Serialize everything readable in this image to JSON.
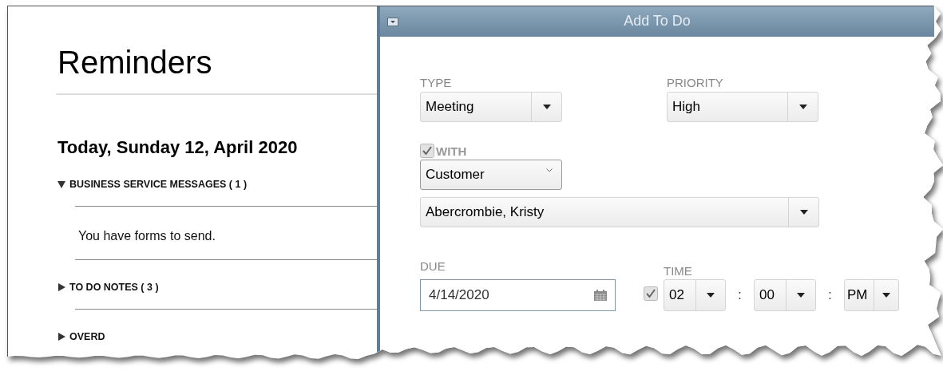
{
  "reminders": {
    "title": "Reminders",
    "date_heading": "Today, Sunday 12, April 2020",
    "sections": [
      {
        "label": "BUSINESS SERVICE MESSAGES ( 1 )",
        "expanded": true,
        "items": [
          "You have forms to send."
        ]
      },
      {
        "label": "TO DO NOTES ( 3 )",
        "expanded": false
      },
      {
        "label": "OVERD",
        "expanded": false
      }
    ]
  },
  "dialog": {
    "title": "Add To Do",
    "type": {
      "label": "TYPE",
      "value": "Meeting"
    },
    "priority": {
      "label": "PRIORITY",
      "value": "High"
    },
    "with": {
      "label": "WITH",
      "checked": true,
      "category": "Customer",
      "name": "Abercrombie, Kristy"
    },
    "due": {
      "label": "DUE",
      "value": "4/14/2020"
    },
    "time": {
      "label": "TIME",
      "checked": true,
      "hour": "02",
      "minute": "00",
      "period": "PM",
      "separators": [
        ":",
        ":"
      ]
    }
  }
}
